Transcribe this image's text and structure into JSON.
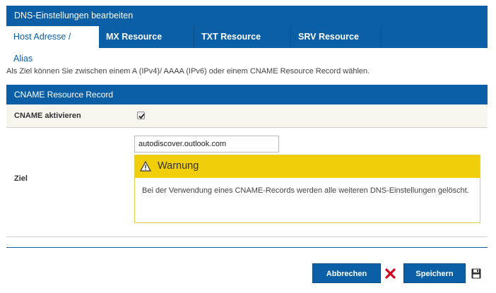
{
  "window": {
    "title": "DNS-Einstellungen bearbeiten"
  },
  "tabs": [
    {
      "label": "Host Adresse / Alias",
      "active": true
    },
    {
      "label": "MX Resource Record",
      "active": false
    },
    {
      "label": "TXT Resource Record",
      "active": false
    },
    {
      "label": "SRV Resource Record",
      "active": false
    }
  ],
  "intro_text": "Als Ziel können Sie zwischen einem A (IPv4)/ AAAA (IPv6) oder einem CNAME Resource Record wählen.",
  "section": {
    "title": "CNAME Resource Record",
    "cname": {
      "label": "CNAME aktivieren",
      "checked": true
    },
    "ziel": {
      "label": "Ziel",
      "value": "autodiscover.outlook.com"
    }
  },
  "warning": {
    "icon": "warning-triangle-icon",
    "title": "Warnung",
    "message": "Bei der Verwendung eines CNAME-Records werden alle weiteren DNS-Einstellungen gelöscht."
  },
  "footer": {
    "cancel_label": "Abbrechen",
    "cancel_icon": "close-x-icon",
    "save_label": "Speichern",
    "save_icon": "floppy-disk-icon"
  },
  "colors": {
    "primary": "#0a5fa6",
    "warning": "#f0cf0a",
    "cancel_icon": "#d0021b"
  }
}
